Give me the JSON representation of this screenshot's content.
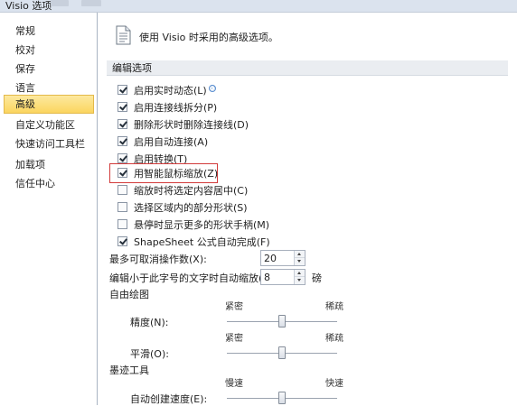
{
  "window": {
    "title": "Visio 选项"
  },
  "nav": {
    "items": [
      {
        "label": "常规",
        "active": false
      },
      {
        "label": "校对",
        "active": false
      },
      {
        "label": "保存",
        "active": false
      },
      {
        "label": "语言",
        "active": false
      },
      {
        "label": "高级",
        "active": true
      },
      {
        "label": "自定义功能区",
        "active": false
      },
      {
        "label": "快速访问工具栏",
        "active": false
      },
      {
        "label": "加载项",
        "active": false
      },
      {
        "label": "信任中心",
        "active": false
      }
    ]
  },
  "header": {
    "text": "使用 Visio 时采用的高级选项。",
    "icon": "options-document-icon"
  },
  "section_edit": {
    "title": "编辑选项"
  },
  "options": [
    {
      "label": "启用实时动态(L)",
      "checked": true,
      "info": "ⓘ"
    },
    {
      "label": "启用连接线拆分(P)",
      "checked": true
    },
    {
      "label": "删除形状时删除连接线(D)",
      "checked": true
    },
    {
      "label": "启用自动连接(A)",
      "checked": true
    },
    {
      "label": "启用转换(T)",
      "checked": true
    },
    {
      "label": "用智能鼠标缩放(Z)",
      "checked": true
    },
    {
      "label": "缩放时将选定内容居中(C)",
      "checked": false
    },
    {
      "label": "选择区域内的部分形状(S)",
      "checked": false
    },
    {
      "label": "悬停时显示更多的形状手柄(M)",
      "checked": false
    },
    {
      "label": "ShapeSheet 公式自动完成(F)",
      "checked": true
    }
  ],
  "undo": {
    "label": "最多可取消操作数(X):",
    "value": "20"
  },
  "zoom_text": {
    "label": "编辑小于此字号的文字时自动缩放(T):",
    "value": "8",
    "unit": "磅"
  },
  "freeform": {
    "title": "自由绘图",
    "precision": {
      "label": "精度(N):",
      "left": "紧密",
      "right": "稀疏",
      "level": 0.5
    },
    "smoothing": {
      "label": "平滑(O):",
      "left": "紧密",
      "right": "稀疏",
      "level": 0.5
    }
  },
  "ink": {
    "title": "墨迹工具",
    "auto_create": {
      "label": "自动创建速度(E):",
      "left": "慢速",
      "right": "快速",
      "level": 0.5
    }
  },
  "colors": {
    "nav_active": "#fbd55f",
    "highlight_border": "#d23b3b",
    "section_bg": "#eaedf1"
  }
}
